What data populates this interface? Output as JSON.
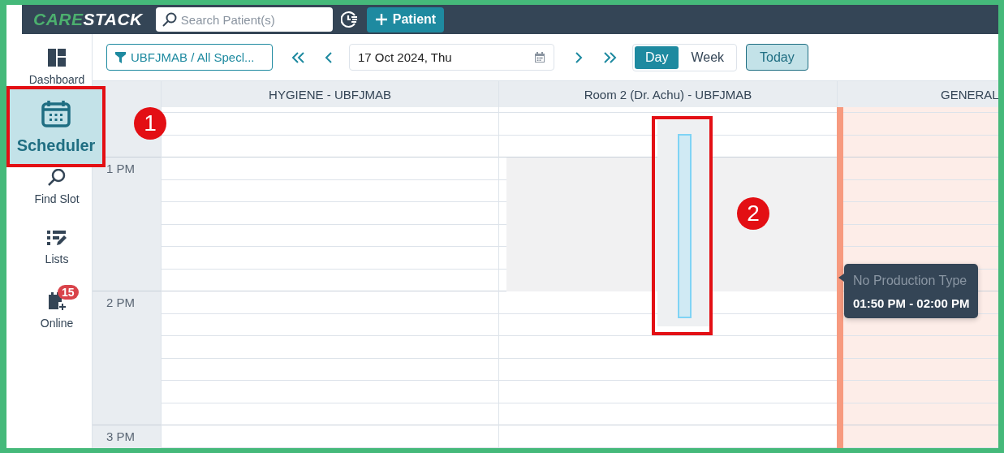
{
  "header": {
    "logo": [
      "CARE",
      "STACK"
    ],
    "search": {
      "placeholder": "Search Patient(s)"
    },
    "add_button": "Patient"
  },
  "sidebar": {
    "items": [
      {
        "label": "Dashboard",
        "selected": false
      },
      {
        "label": "Scheduler",
        "selected": true
      },
      {
        "label": "Find Slot",
        "selected": false
      },
      {
        "label": "Lists",
        "selected": false
      },
      {
        "label": "Online",
        "selected": false,
        "badge": "15"
      }
    ]
  },
  "toolbar": {
    "filter": "UBFJMAB / All Specl...",
    "date": "17 Oct 2024, Thu",
    "views": [
      {
        "label": "Day",
        "selected": true
      },
      {
        "label": "Week",
        "selected": false
      }
    ],
    "today": "Today"
  },
  "columns": [
    {
      "title": "HYGIENE - UBFJMAB",
      "kind": "open"
    },
    {
      "title": "Room 2 (Dr. Achu) - UBFJMAB",
      "kind": "blocked"
    },
    {
      "title": "GENERAL",
      "kind": "closed"
    }
  ],
  "time_labels": [
    "1 PM",
    "2 PM",
    "3 PM"
  ],
  "tooltip": {
    "title": "No Production Type",
    "time": "01:50 PM - 02:00 PM"
  },
  "callouts": [
    "1",
    "2"
  ]
}
